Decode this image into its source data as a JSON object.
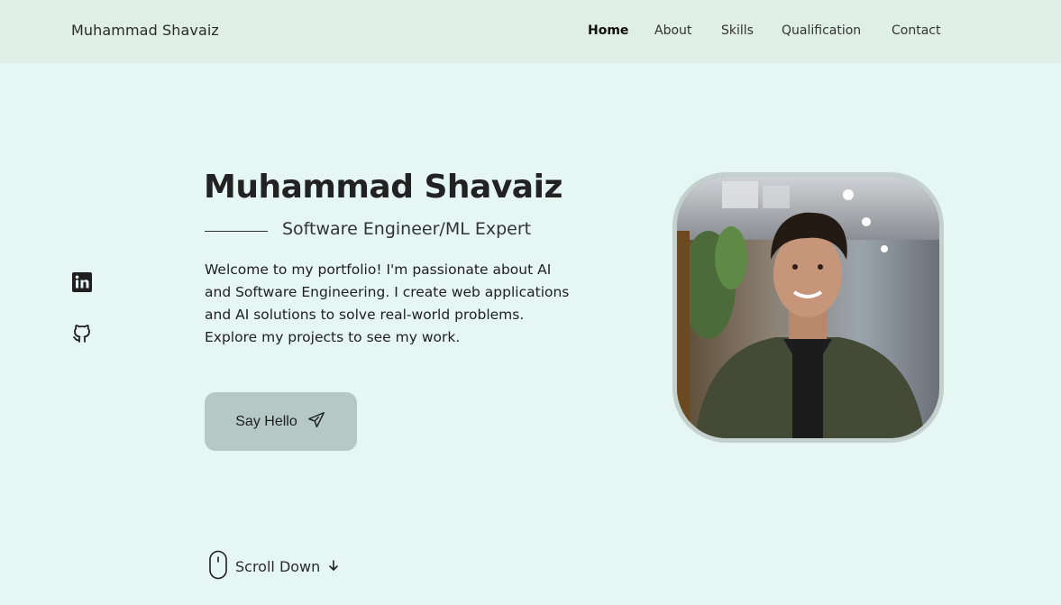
{
  "header": {
    "logo": "Muhammad Shavaiz",
    "nav": [
      {
        "label": "Home",
        "active": true
      },
      {
        "label": "About",
        "active": false
      },
      {
        "label": "Skills",
        "active": false
      },
      {
        "label": "Qualification",
        "active": false
      },
      {
        "label": "Contact",
        "active": false
      }
    ]
  },
  "social": [
    {
      "icon": "linkedin-icon"
    },
    {
      "icon": "github-icon"
    }
  ],
  "hero": {
    "name": "Muhammad Shavaiz",
    "subtitle": "Software Engineer/ML Expert",
    "description": "Welcome to my portfolio! I'm passionate about AI and Software Engineering. I create web applications and AI solutions to solve real-world problems. Explore my projects to see my work.",
    "cta_label": "Say Hello",
    "cta_icon": "send-icon"
  },
  "scroll": {
    "label": "Scroll Down",
    "icon": "mouse-icon",
    "arrow_icon": "arrow-down-icon"
  },
  "colors": {
    "background": "#e6f6f2",
    "header": "#e0eee8",
    "button": "#b5c8c5",
    "text": "#1f1f1f"
  }
}
